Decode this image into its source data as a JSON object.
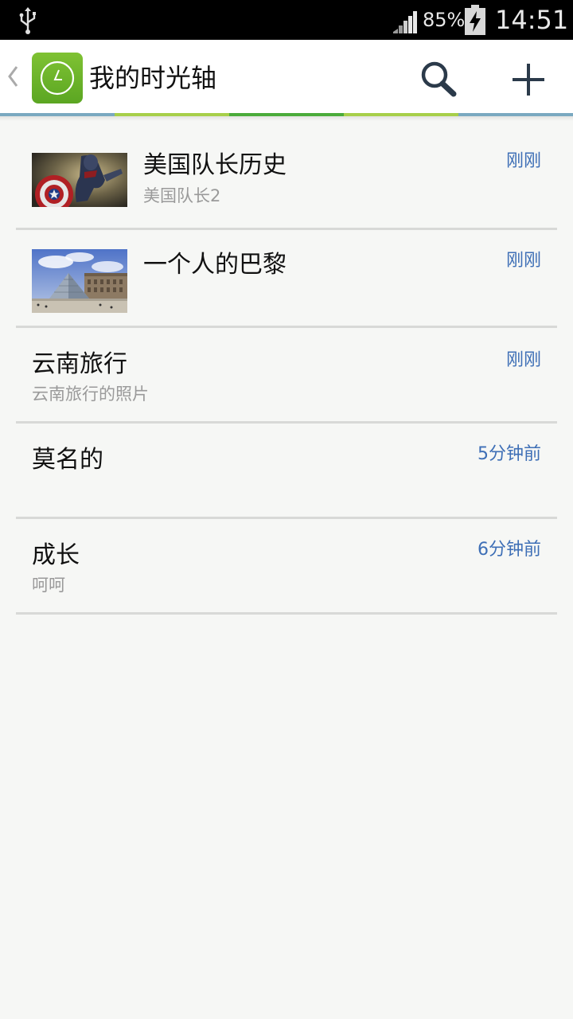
{
  "status_bar": {
    "usb_icon": "usb-icon",
    "signal_icon": "signal-icon",
    "battery_percent": "85%",
    "battery_icon": "battery-charging-icon",
    "time": "14:51"
  },
  "app_bar": {
    "back_icon": "chevron-left-icon",
    "logo_icon": "clock-icon",
    "title": "我的时光轴",
    "search_icon": "search-icon",
    "add_icon": "plus-icon",
    "accent_colors": [
      "#7aa9c0",
      "#a7cf4a",
      "#4aab3a",
      "#a7cf4a",
      "#7aa9c0"
    ]
  },
  "timelines": [
    {
      "title": "美国队长历史",
      "subtitle": "美国队长2",
      "time": "刚刚",
      "thumbnail": "captain-america-poster"
    },
    {
      "title": "一个人的巴黎",
      "subtitle": "",
      "time": "刚刚",
      "thumbnail": "louvre-pyramid-photo"
    },
    {
      "title": "云南旅行",
      "subtitle": "云南旅行的照片",
      "time": "刚刚",
      "thumbnail": ""
    },
    {
      "title": "莫名的",
      "subtitle": "",
      "time": "5分钟前",
      "thumbnail": ""
    },
    {
      "title": "成长",
      "subtitle": "呵呵",
      "time": "6分钟前",
      "thumbnail": ""
    }
  ],
  "colors": {
    "time_text": "#3e6fb6",
    "brand_green": "#6cb52c",
    "background": "#f6f7f5"
  }
}
